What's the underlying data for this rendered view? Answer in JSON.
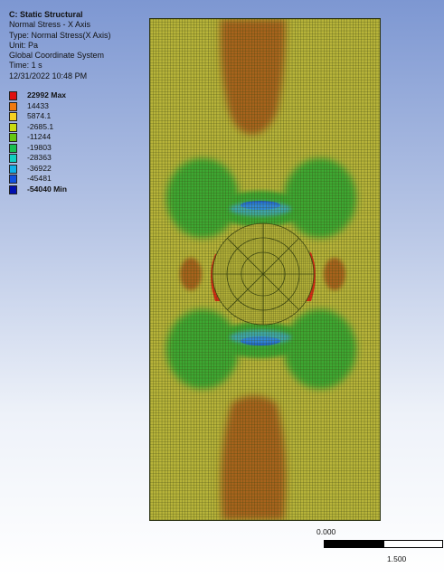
{
  "header": {
    "title": "C: Static Structural",
    "result": "Normal Stress - X Axis",
    "type": "Type: Normal Stress(X Axis)",
    "unit": "Unit: Pa",
    "coord": "Global Coordinate System",
    "time": "Time: 1 s",
    "timestamp": "12/31/2022 10:48 PM"
  },
  "legend": {
    "entries": [
      {
        "label": "22992 Max",
        "color": "#e01010",
        "bold": true
      },
      {
        "label": "14433",
        "color": "#f07a10",
        "bold": false
      },
      {
        "label": "5874.1",
        "color": "#f4d020",
        "bold": false
      },
      {
        "label": "-2685.1",
        "color": "#c8dc10",
        "bold": false
      },
      {
        "label": "-11244",
        "color": "#64c810",
        "bold": false
      },
      {
        "label": "-19803",
        "color": "#18c050",
        "bold": false
      },
      {
        "label": "-28363",
        "color": "#10d0c0",
        "bold": false
      },
      {
        "label": "-36922",
        "color": "#10b0e8",
        "bold": false
      },
      {
        "label": "-45481",
        "color": "#1050e0",
        "bold": false
      },
      {
        "label": "-54040 Min",
        "color": "#0010b0",
        "bold": true
      }
    ]
  },
  "model": {
    "colors": {
      "base": "#b8b43a",
      "tension_zone": "#a8641e",
      "compression_zone": "#3ca832",
      "max_stress": "#d82a14",
      "min_stress": "#1040c8",
      "mesh_line": "#3a4410"
    }
  },
  "scale_bar": {
    "start_label": "0.000",
    "end_label": "1.500"
  }
}
